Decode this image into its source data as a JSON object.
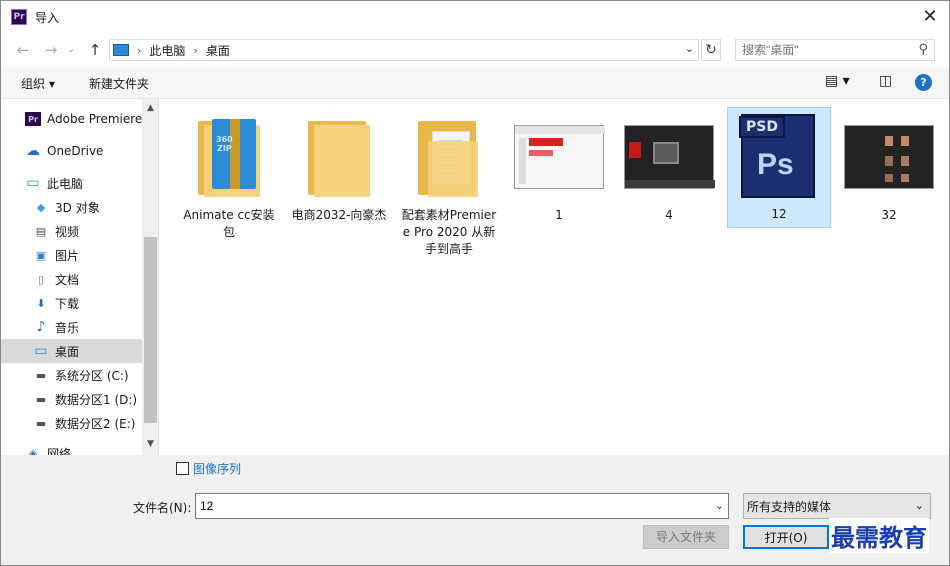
{
  "window": {
    "title": "导入",
    "app_icon": "Pr",
    "close_glyph": "✕"
  },
  "nav": {
    "back": "←",
    "forward": "→",
    "up": "↑"
  },
  "address": {
    "crumbs": [
      "此电脑",
      "桌面"
    ],
    "separator": "›"
  },
  "search": {
    "placeholder": "搜索\"桌面\""
  },
  "toolbar": {
    "organize": "组织 ▾",
    "new_folder": "新建文件夹",
    "help": "?"
  },
  "sidebar": {
    "items": [
      {
        "label": "Adobe Premiere",
        "icon": "Pr"
      },
      {
        "label": "OneDrive",
        "icon": "☁"
      },
      {
        "label": "此电脑",
        "icon": "▭"
      },
      {
        "label": "3D 对象",
        "icon": "◆"
      },
      {
        "label": "视频",
        "icon": "▤"
      },
      {
        "label": "图片",
        "icon": "▣"
      },
      {
        "label": "文档",
        "icon": "▯"
      },
      {
        "label": "下载",
        "icon": "⬇"
      },
      {
        "label": "音乐",
        "icon": "♪"
      },
      {
        "label": "桌面",
        "icon": "▭"
      },
      {
        "label": "系统分区 (C:)",
        "icon": "▬"
      },
      {
        "label": "数据分区1 (D:)",
        "icon": "▬"
      },
      {
        "label": "数据分区2 (E:)",
        "icon": "▬"
      },
      {
        "label": "网络",
        "icon": "◈"
      }
    ],
    "selected": "桌面"
  },
  "files": [
    {
      "name": "Animate cc安装包",
      "kind": "zip-folder"
    },
    {
      "name": "电商2032-向豪杰",
      "kind": "folder"
    },
    {
      "name": "配套素材Premiere Pro 2020 从新手到高手",
      "kind": "doc-folder"
    },
    {
      "name": "1",
      "kind": "screenshot-light"
    },
    {
      "name": "4",
      "kind": "screenshot-dark"
    },
    {
      "name": "12",
      "kind": "psd",
      "selected": true,
      "badge": "PSD",
      "logo": "Ps"
    },
    {
      "name": "32",
      "kind": "screenshot-dark"
    }
  ],
  "zip_text": "360\nZIP",
  "bottom": {
    "image_sequence_label": "图像序列",
    "filename_label": "文件名(N):",
    "filename_value": "12",
    "filetype_value": "所有支持的媒体",
    "import_folder_button": "导入文件夹",
    "open_button": "打开(O)",
    "watermark": "最需教育"
  },
  "colors": {
    "accent": "#0078d7",
    "selection": "#cce8ff",
    "folder": "#f5d27a"
  }
}
